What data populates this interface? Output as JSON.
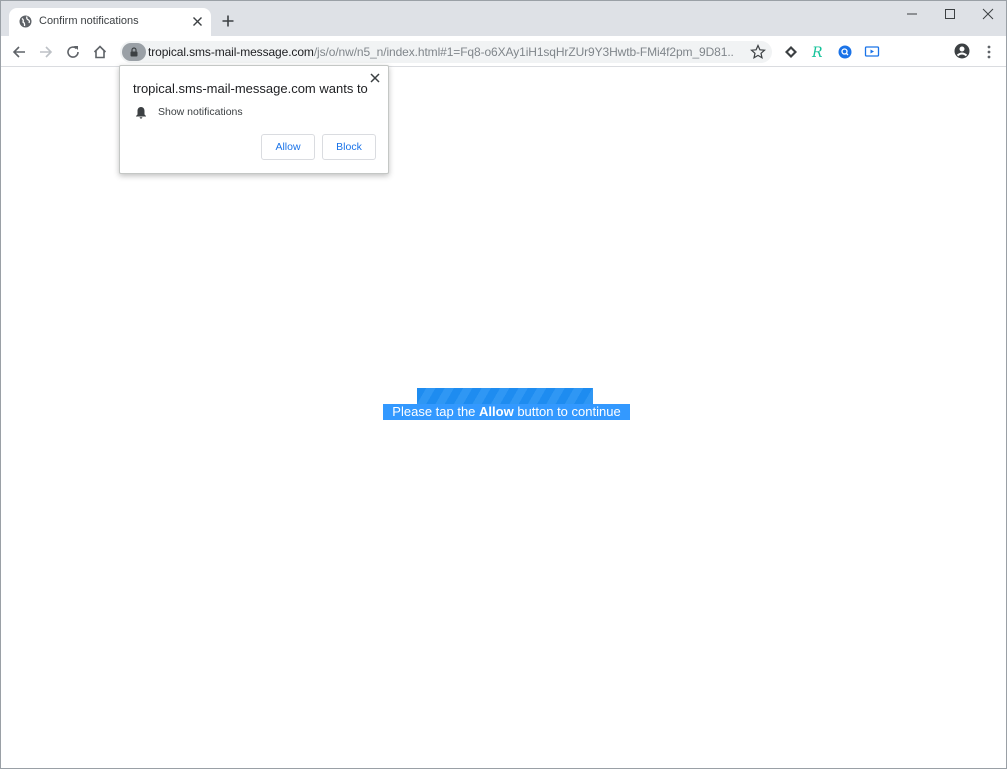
{
  "tab": {
    "title": "Confirm notifications",
    "favicon": "globe-icon",
    "close_icon": "close-icon"
  },
  "window_controls": [
    "minimize-icon",
    "maximize-icon",
    "close-icon"
  ],
  "toolbar": {
    "url_host": "tropical.sms-mail-message.com",
    "url_path": "/js/o/nw/n5_n/index.html#1=Fq8-o6XAy1iH1sqHrZUr9Y3Hwtb-FMi4f2pm_9D81...",
    "icons": [
      "back-icon",
      "forward-icon",
      "reload-icon",
      "home-icon",
      "lock-icon",
      "star-icon",
      "extension-icon",
      "grammarly-icon",
      "search-extension-icon",
      "media-extension-icon",
      "profile-icon",
      "menu-icon"
    ]
  },
  "permission": {
    "title": "tropical.sms-mail-message.com wants to",
    "item": "Show notifications",
    "allow_label": "Allow",
    "block_label": "Block"
  },
  "page": {
    "cta_prefix": "Please tap the ",
    "cta_bold": "Allow",
    "cta_suffix": " button to continue"
  },
  "colors": {
    "accent": "#1a73e8",
    "cta_background": "#3399ff",
    "progress": "#1e8cf0"
  }
}
